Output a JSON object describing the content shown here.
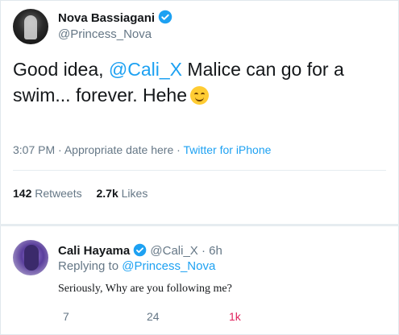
{
  "tweet": {
    "author_name": "Nova Bassiagani",
    "author_handle": "@Princess_Nova",
    "verified": true,
    "text_before": "Good idea, ",
    "mention": "@Cali_X",
    "text_after": " Malice can go for a swim... forever. Hehe",
    "emoji": "smiling-face-icon",
    "time": "3:07 PM",
    "date": "Appropriate date here",
    "source": "Twitter for iPhone",
    "retweets_count": "142",
    "retweets_label": "Retweets",
    "likes_count": "2.7k",
    "likes_label": "Likes"
  },
  "reply": {
    "author_name": "Cali Hayama",
    "verified": true,
    "author_handle": "@Cali_X",
    "age": "6h",
    "replying_label": "Replying to",
    "replying_to": "@Princess_Nova",
    "text": "Seriously, Why are you following me?",
    "reply_count": "7",
    "retweet_count": "24",
    "like_count": "1k"
  },
  "colors": {
    "accent": "#1da1f2",
    "secondary_text": "#657786",
    "like": "#e0245e"
  }
}
